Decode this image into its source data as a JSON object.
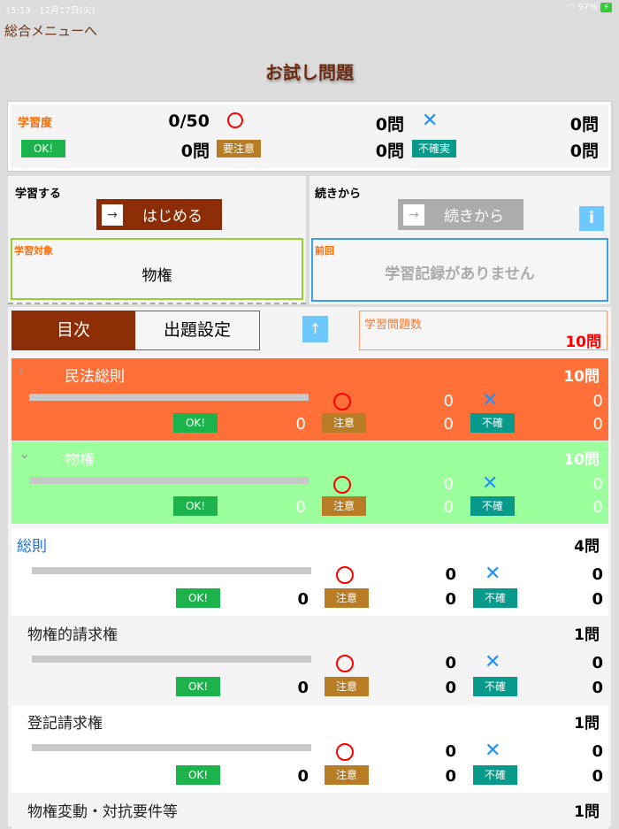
{
  "status": {
    "time": "15:13",
    "date": "12月17日(火)",
    "battery": "97%"
  },
  "nav": {
    "back": "総合メニューへ",
    "title": "お試し問題"
  },
  "summary": {
    "label": "学習度",
    "progress": "0/50",
    "correct": "0問",
    "wrong": "0問",
    "ok_label": "OK!",
    "ok": "0問",
    "caution_label": "要注意",
    "caution": "0問",
    "unsure_label": "不確実",
    "unsure": "0問"
  },
  "study": {
    "label": "学習する",
    "start": "はじめる",
    "target_label": "学習対象",
    "target": "物権"
  },
  "resume": {
    "label": "続きから",
    "button": "続きから",
    "info": "i",
    "prev_label": "前回",
    "prev": "学習記録がありません"
  },
  "tabs": {
    "toc": "目次",
    "settings": "出題設定",
    "up": "↑"
  },
  "count": {
    "label": "学習問題数",
    "value": "10問"
  },
  "badges": {
    "ok": "OK!",
    "caution": "注意",
    "unsure": "不確"
  },
  "colors": {
    "orange": "#ff7038",
    "green": "#9bff9b",
    "brown": "#8c2d05"
  },
  "rows": [
    {
      "title": "民法総則",
      "count": "10問",
      "chev": "›",
      "style": "orange",
      "correct": "0",
      "wrong": "0",
      "ok": "0",
      "caution": "0",
      "unsure": "0"
    },
    {
      "title": "物権",
      "count": "10問",
      "chev": "⌄",
      "style": "green",
      "correct": "0",
      "wrong": "0",
      "ok": "0",
      "caution": "0",
      "unsure": "0"
    },
    {
      "title": "総則",
      "count": "4問",
      "style": "white-blue",
      "correct": "0",
      "wrong": "0",
      "ok": "0",
      "caution": "0",
      "unsure": "0"
    },
    {
      "title": "物権的請求権",
      "count": "1問",
      "style": "gray",
      "correct": "0",
      "wrong": "0",
      "ok": "0",
      "caution": "0",
      "unsure": "0"
    },
    {
      "title": "登記請求権",
      "count": "1問",
      "style": "white",
      "correct": "0",
      "wrong": "0",
      "ok": "0",
      "caution": "0",
      "unsure": "0"
    },
    {
      "title": "物権変動・対抗要件等",
      "count": "1問",
      "style": "gray",
      "partial": true
    }
  ]
}
